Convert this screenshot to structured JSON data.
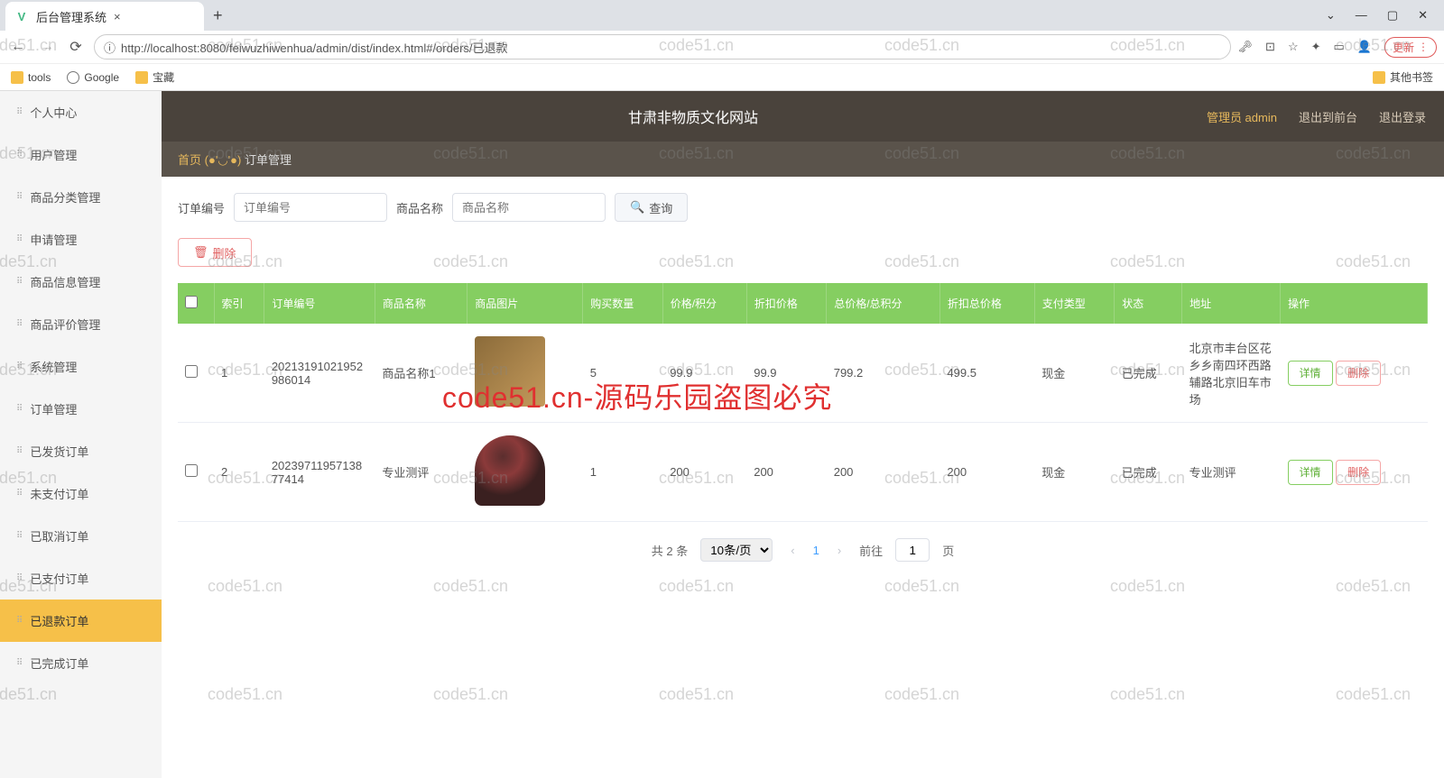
{
  "browser": {
    "tab_title": "后台管理系统",
    "url": "http://localhost:8080/feiwuzhiwenhua/admin/dist/index.html#/orders/已退款",
    "update_btn": "更新",
    "bookmarks": {
      "tools": "tools",
      "google": "Google",
      "treasure": "宝藏",
      "other": "其他书签"
    }
  },
  "header": {
    "title": "甘肃非物质文化网站",
    "admin_label": "管理员 admin",
    "to_front": "退出到前台",
    "logout": "退出登录"
  },
  "crumb": {
    "home": "首页",
    "face": "(●'◡'●)",
    "current": "订单管理"
  },
  "sidebar": [
    "个人中心",
    "用户管理",
    "商品分类管理",
    "申请管理",
    "商品信息管理",
    "商品评价管理",
    "系统管理",
    "订单管理",
    "已发货订单",
    "未支付订单",
    "已取消订单",
    "已支付订单",
    "已退款订单",
    "已完成订单"
  ],
  "sidebar_active_index": 12,
  "search": {
    "order_label": "订单编号",
    "order_ph": "订单编号",
    "name_label": "商品名称",
    "name_ph": "商品名称",
    "query_btn": "查询",
    "delete_btn": "删除"
  },
  "table": {
    "headers": [
      "",
      "索引",
      "订单编号",
      "商品名称",
      "商品图片",
      "购买数量",
      "价格/积分",
      "折扣价格",
      "总价格/总积分",
      "折扣总价格",
      "支付类型",
      "状态",
      "地址",
      "操作"
    ],
    "rows": [
      {
        "idx": "1",
        "order": "202131910219529860​14",
        "name": "商品名称1",
        "qty": "5",
        "price": "99.9",
        "dprice": "99.9",
        "total": "799.2",
        "dtotal": "499.5",
        "pay": "现金",
        "status": "已完成",
        "addr": "北京市丰台区花乡乡南四环西路辅路北京旧车市场"
      },
      {
        "idx": "2",
        "order": "202397119571387741​4",
        "name": "专业测评",
        "qty": "1",
        "price": "200",
        "dprice": "200",
        "total": "200",
        "dtotal": "200",
        "pay": "现金",
        "status": "已完成",
        "addr": "专业测评"
      }
    ],
    "detail_btn": "详情",
    "del_btn": "删除"
  },
  "pager": {
    "total": "共 2 条",
    "size": "10条/页",
    "current": "1",
    "goto_pre": "前往",
    "goto_suf": "页",
    "page_input": "1"
  },
  "overlay": "code51.cn-源码乐园盗图必究",
  "watermark": "code51.cn"
}
